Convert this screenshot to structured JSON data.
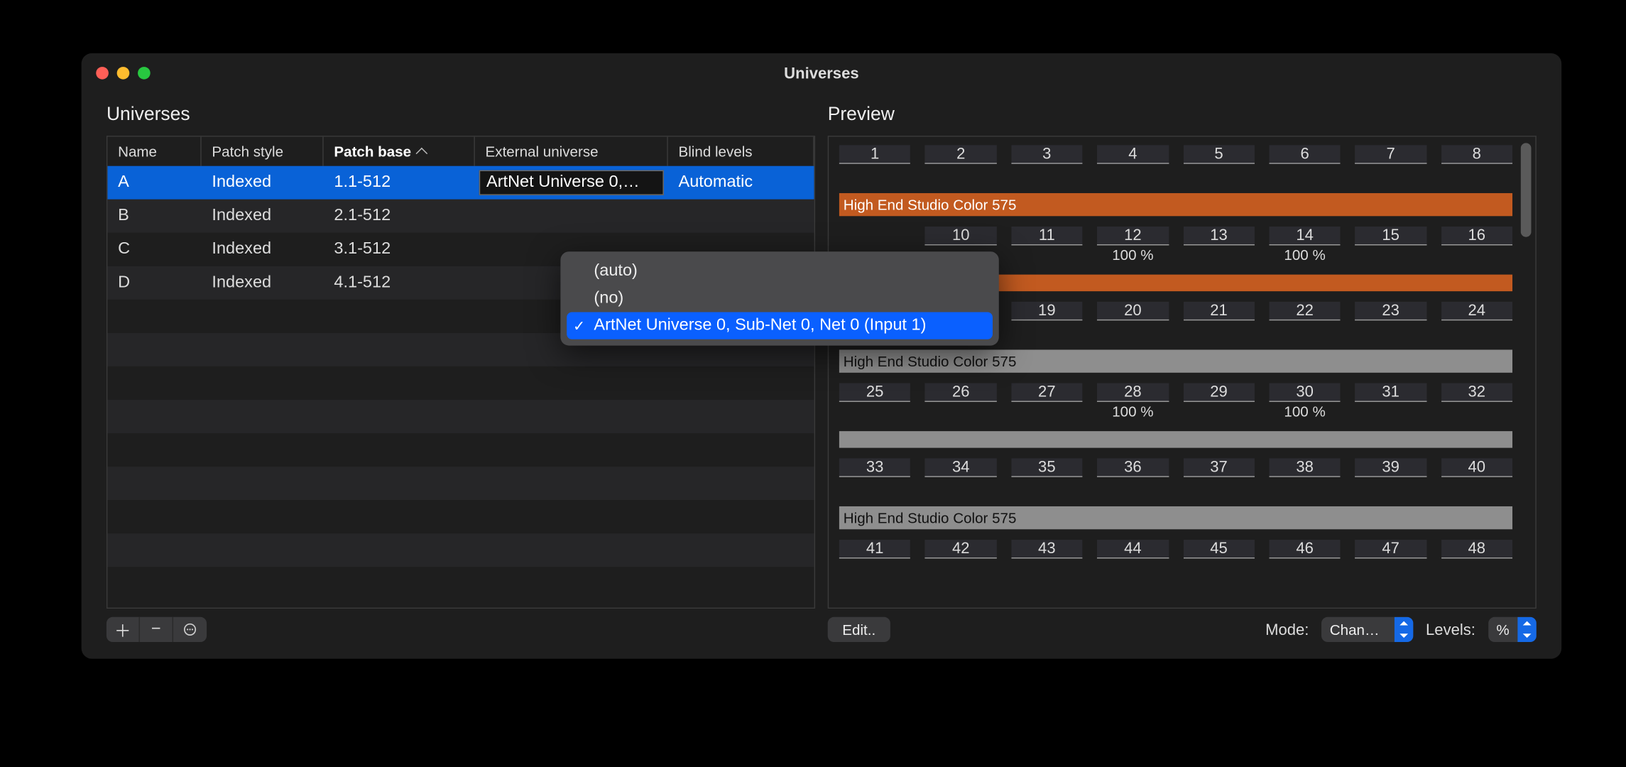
{
  "window_title": "Universes",
  "left": {
    "title": "Universes",
    "columns": {
      "name": "Name",
      "patch_style": "Patch style",
      "patch_base": "Patch base",
      "external": "External universe",
      "blind": "Blind levels"
    },
    "rows": [
      {
        "name": "A",
        "style": "Indexed",
        "base": "1.1-512",
        "ext": "ArtNet Universe 0,…",
        "blind": "Automatic",
        "selected": true
      },
      {
        "name": "B",
        "style": "Indexed",
        "base": "2.1-512",
        "ext": "",
        "blind": ""
      },
      {
        "name": "C",
        "style": "Indexed",
        "base": "3.1-512",
        "ext": "",
        "blind": ""
      },
      {
        "name": "D",
        "style": "Indexed",
        "base": "4.1-512",
        "ext": "",
        "blind": ""
      }
    ]
  },
  "dropdown": {
    "items": [
      {
        "label": "(auto)",
        "selected": false
      },
      {
        "label": "(no)",
        "selected": false
      },
      {
        "label": "ArtNet Universe 0, Sub-Net 0, Net 0 (Input 1)",
        "selected": true
      }
    ]
  },
  "preview": {
    "title": "Preview",
    "fixture_label": "High End Studio Color 575",
    "values": {
      "12": "100 %",
      "14": "100 %",
      "28": "100 %",
      "30": "100 %"
    },
    "blocks": [
      {
        "type": "row",
        "from": 1,
        "to": 8
      },
      {
        "type": "fixture",
        "style": "orange",
        "text": "High End Studio Color 575"
      },
      {
        "type": "row",
        "from": 10,
        "to": 16,
        "offset": 1
      },
      {
        "type": "fixture",
        "style": "orange",
        "text": ""
      },
      {
        "type": "row",
        "from": 18,
        "to": 24,
        "offset": 1
      },
      {
        "type": "fixture",
        "style": "gray",
        "text": "High End Studio Color 575"
      },
      {
        "type": "row",
        "from": 25,
        "to": 32
      },
      {
        "type": "fixture",
        "style": "gray",
        "text": ""
      },
      {
        "type": "row",
        "from": 33,
        "to": 40
      },
      {
        "type": "fixture",
        "style": "gray",
        "text": "High End Studio Color 575"
      },
      {
        "type": "row",
        "from": 41,
        "to": 48
      }
    ]
  },
  "toolbar": {
    "edit": "Edit..",
    "mode_label": "Mode:",
    "mode_value": "Chann…",
    "levels_label": "Levels:",
    "levels_value": "%"
  }
}
